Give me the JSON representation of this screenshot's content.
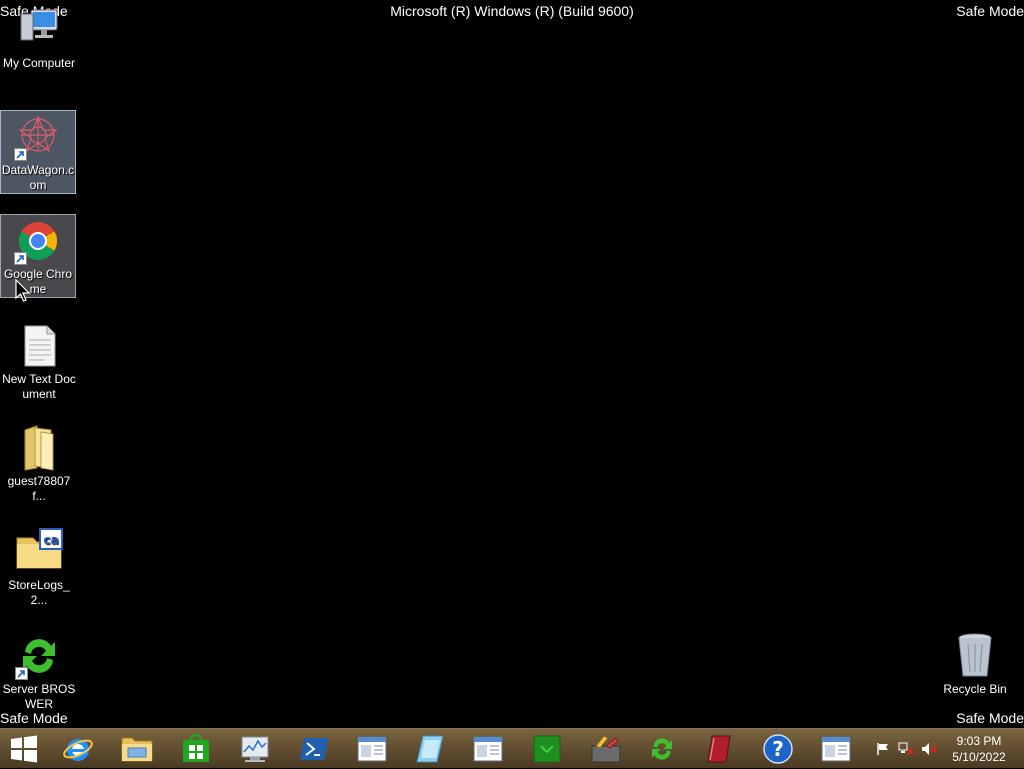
{
  "screen": {
    "safe_mode_label": "Safe Mode",
    "build_text": "Microsoft (R) Windows (R) (Build 9600)"
  },
  "desktop_icons": [
    {
      "label": "My Computer",
      "icon": "computer-icon"
    },
    {
      "label": "DataWagon.com",
      "icon": "datawagon-icon",
      "shortcut": true,
      "selected": true
    },
    {
      "label": "Google Chrome",
      "icon": "chrome-icon",
      "shortcut": true,
      "selected": true
    },
    {
      "label": "New Text Document",
      "icon": "text-document-icon"
    },
    {
      "label": "guest78807f...",
      "icon": "folder-icon"
    },
    {
      "label": "StoreLogs_2...",
      "icon": "storelogs-icon"
    },
    {
      "label": "Server BROSWER",
      "icon": "sync-arrows-icon",
      "shortcut": true
    },
    {
      "label": "Recycle Bin",
      "icon": "recycle-bin-icon"
    }
  ],
  "taskbar": {
    "start_icon": "windows-start-icon",
    "pinned": [
      "internet-explorer-icon",
      "file-explorer-icon",
      "store-icon",
      "performance-monitor-icon",
      "powershell-icon",
      "window-app-icon",
      "notepad-icon",
      "window-app-icon",
      "green-app-icon",
      "tools-icon",
      "sync-arrows-icon",
      "book-icon",
      "help-icon",
      "window-app-icon"
    ]
  },
  "tray": {
    "icons": [
      "flag-icon",
      "network-error-icon",
      "volume-muted-icon"
    ],
    "time": "9:03 PM",
    "date": "5/10/2022"
  },
  "colors": {
    "desktop_bg": "#000000",
    "taskbar_bg": "#5a4a2e",
    "chrome_red": "#db4437",
    "chrome_green": "#0f9d58",
    "chrome_yellow": "#f4b400",
    "chrome_blue": "#4285f4"
  }
}
